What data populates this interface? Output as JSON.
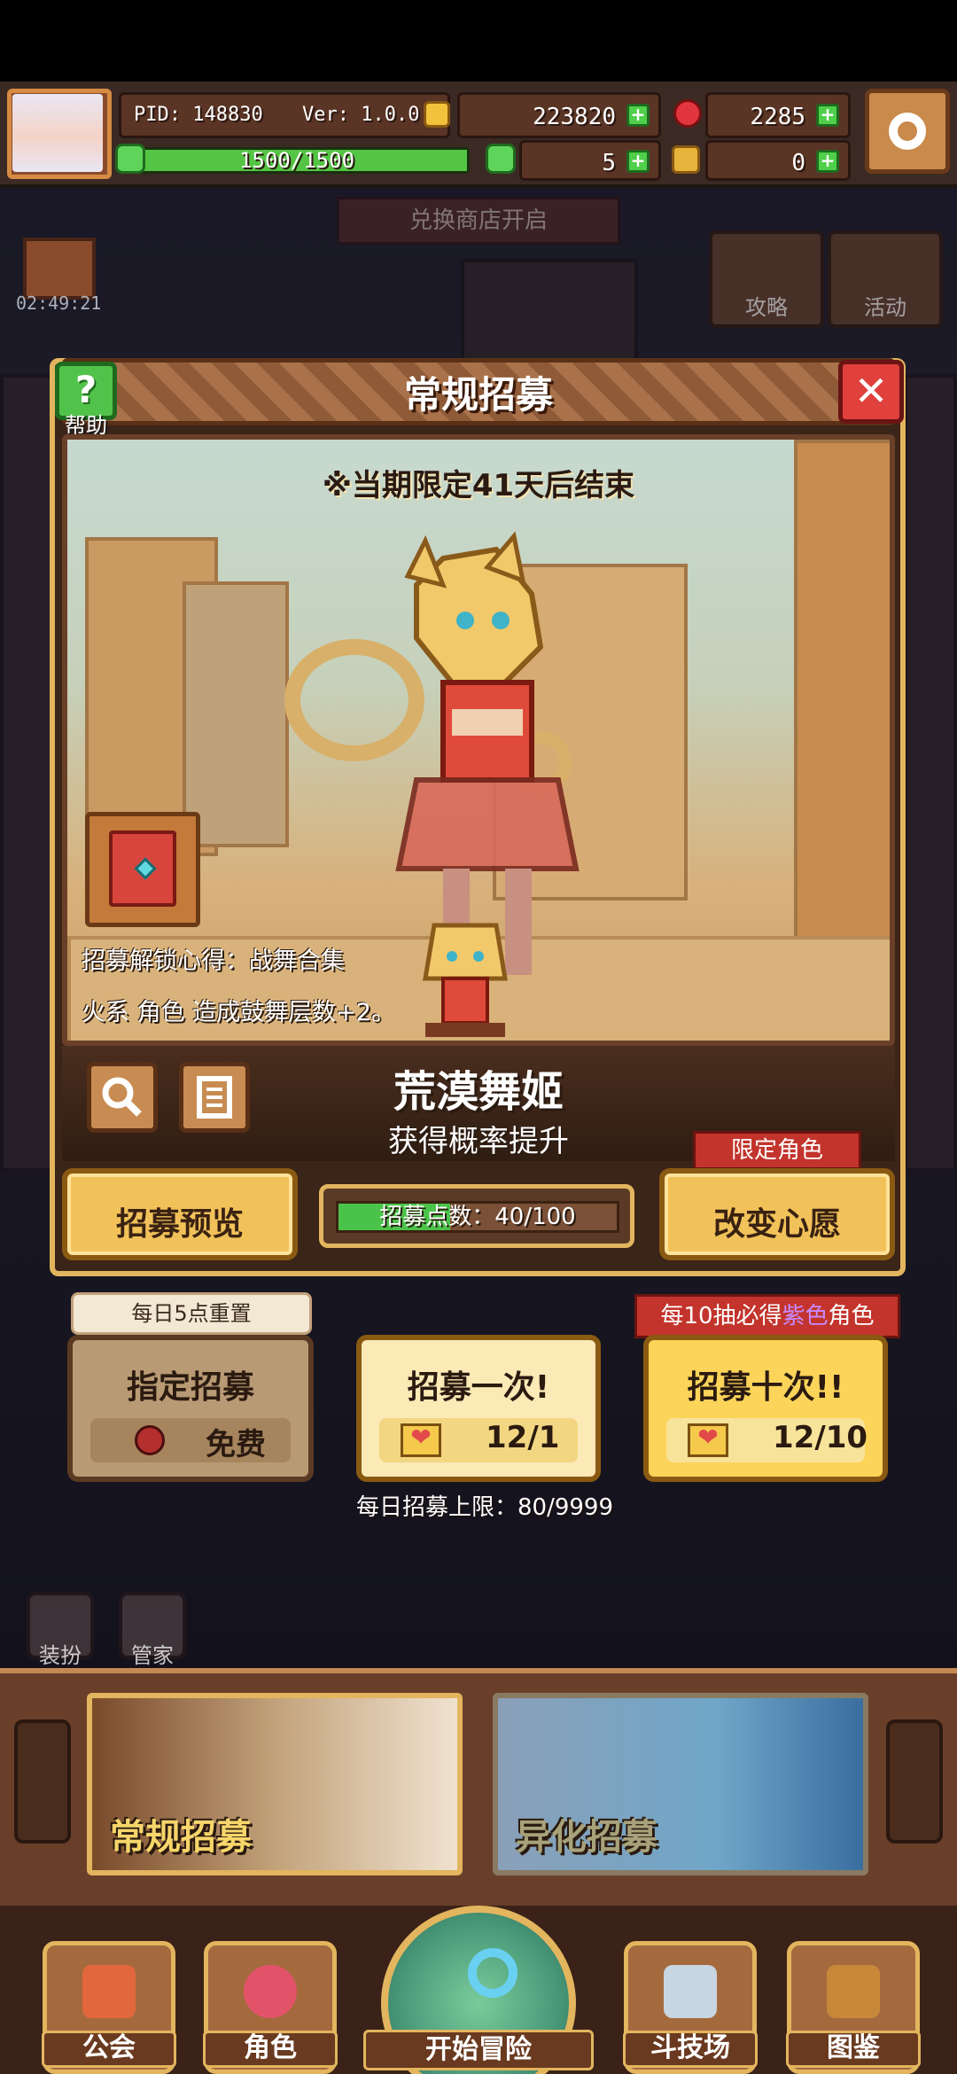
{
  "hud": {
    "pid": "PID: 148830",
    "version": "Ver: 1.0.0.0",
    "gold": "223820",
    "gems": "2285",
    "stamina": "1500/1500",
    "stamina_fill": 1.0,
    "clover": "5",
    "keys": "0"
  },
  "background": {
    "timer": "02:49:21",
    "shop_sign": "兑换商店开启",
    "guide": "攻略",
    "event": "活动",
    "dress": "装扮",
    "butler": "管家"
  },
  "panel": {
    "title": "常规招募",
    "help": "帮助",
    "limited_notice": "※当期限定41天后结束",
    "unlock_text": "招募解锁心得：战舞合集",
    "effect_text": "火系 角色 造成鼓舞层数+2。",
    "character_name": "荒漠舞姬",
    "rate_up": "获得概率提升",
    "limited_badge": "限定角色",
    "preview_button": "招募预览",
    "points_label": "招募点数：40/100",
    "points_fill": 0.4,
    "wish_button": "改变心愿"
  },
  "summon": {
    "reset_tag": "每日5点重置",
    "designated": "指定招募",
    "free": "免费",
    "once": "招募一次!",
    "once_cost": "12/1",
    "ten": "招募十次!!",
    "ten_cost": "12/10",
    "ten_tag_pre": "每10抽必得",
    "ten_tag_purple": "紫色",
    "ten_tag_post": "角色",
    "daily_limit": "每日招募上限：80/9999"
  },
  "tabs": {
    "normal": "常规招募",
    "alien": "异化招募"
  },
  "nav": {
    "guild": "公会",
    "character": "角色",
    "adventure": "开始冒险",
    "arena": "斗技场",
    "codex": "图鉴"
  },
  "colors": {
    "accent_gold": "#e2b55e",
    "panel_brown": "#3b2418",
    "purple_text": "#c88bff"
  }
}
